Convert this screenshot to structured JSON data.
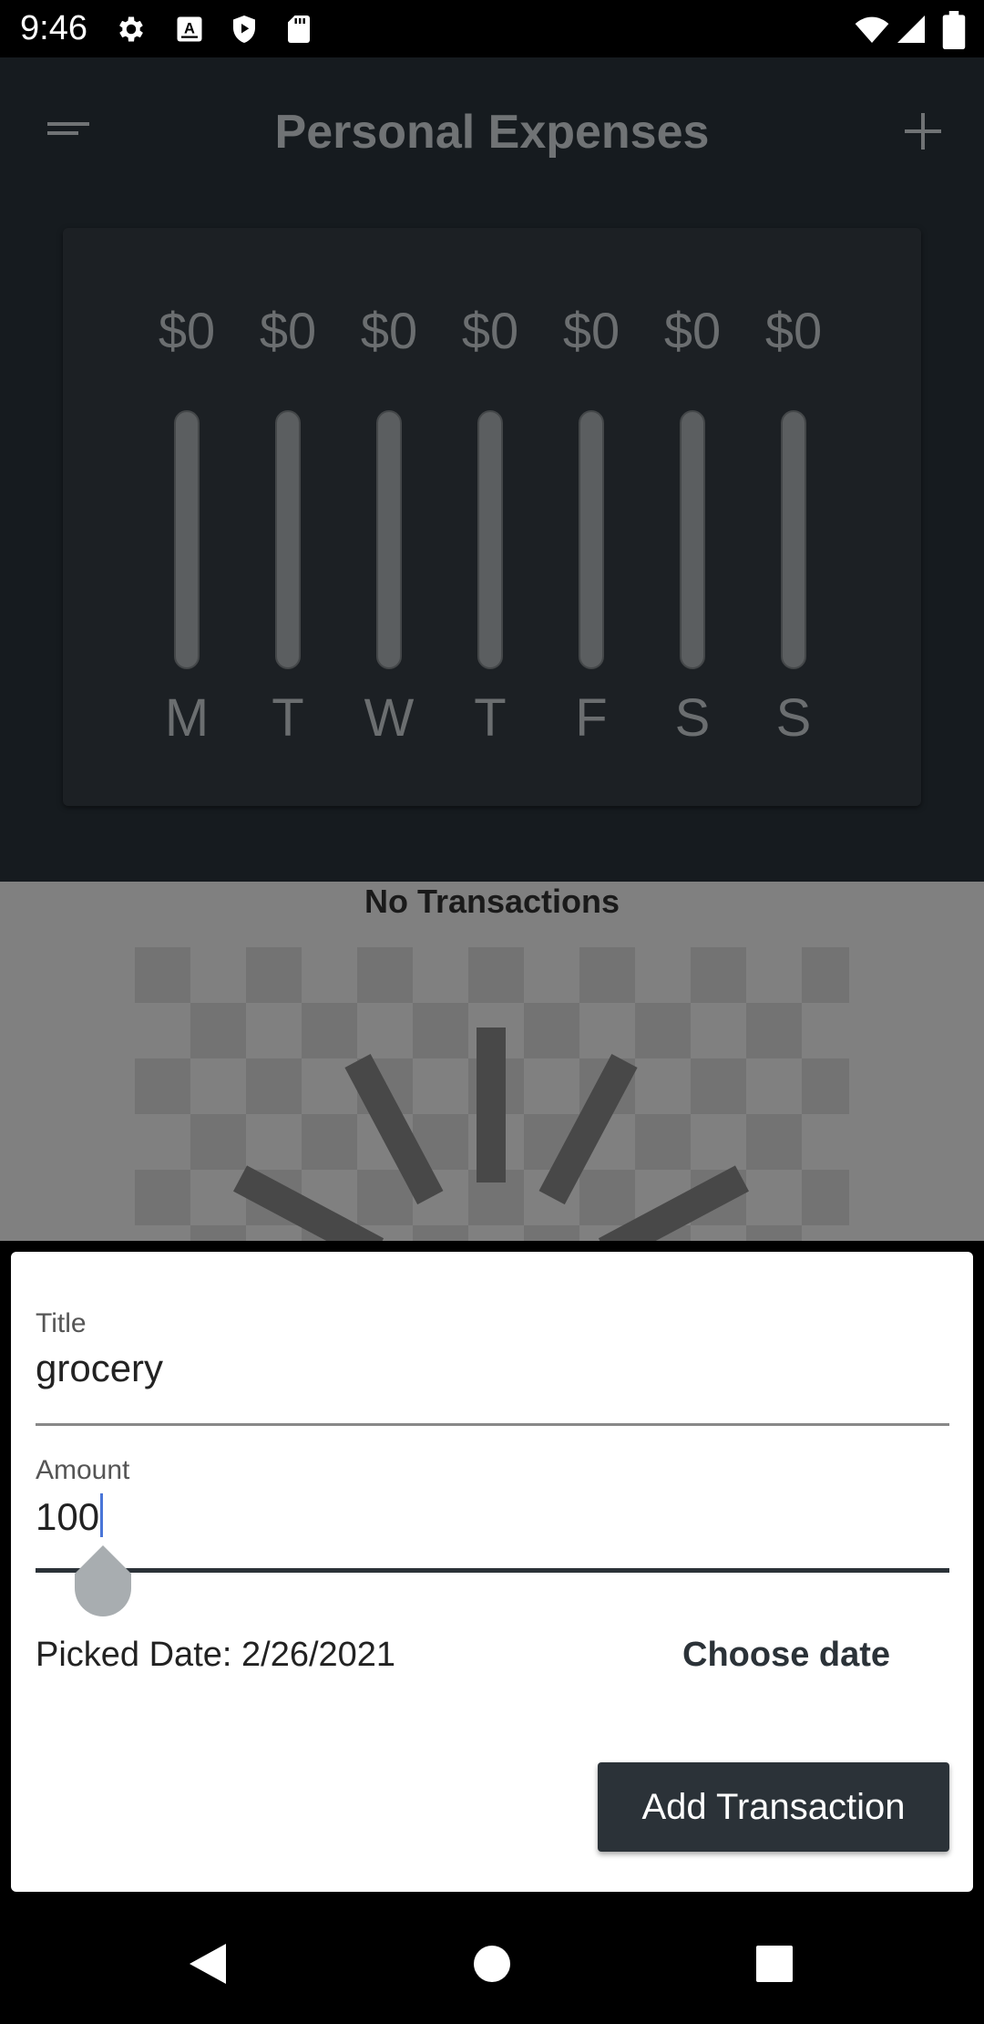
{
  "status_bar": {
    "time": "9:46",
    "left_icons": [
      "gear-icon",
      "a-keyboard-icon",
      "play-protect-icon",
      "sd-card-icon"
    ],
    "right_icons": [
      "wifi-icon",
      "cellular-signal-icon",
      "battery-icon"
    ]
  },
  "app_bar": {
    "title": "Personal Expenses",
    "menu_icon": "menu-icon",
    "add_icon": "plus-icon"
  },
  "chart": {
    "bars": [
      {
        "day": "M",
        "amount": "$0",
        "fill": 0
      },
      {
        "day": "T",
        "amount": "$0",
        "fill": 0
      },
      {
        "day": "W",
        "amount": "$0",
        "fill": 0
      },
      {
        "day": "T",
        "amount": "$0",
        "fill": 0
      },
      {
        "day": "F",
        "amount": "$0",
        "fill": 0
      },
      {
        "day": "S",
        "amount": "$0",
        "fill": 0
      },
      {
        "day": "S",
        "amount": "$0",
        "fill": 0
      }
    ]
  },
  "transactions": {
    "empty_label": "No Transactions"
  },
  "form": {
    "title_label": "Title",
    "title_value": "grocery",
    "amount_label": "Amount",
    "amount_value": "100",
    "picked_date_text": "Picked Date: 2/26/2021",
    "choose_date_label": "Choose date",
    "submit_label": "Add Transaction"
  },
  "nav_bar": {
    "back_icon": "back-triangle-icon",
    "home_icon": "home-circle-icon",
    "recents_icon": "recents-square-icon"
  },
  "colors": {
    "accent_dark": "#2b3238",
    "cursor_blue": "#4a76d8"
  }
}
